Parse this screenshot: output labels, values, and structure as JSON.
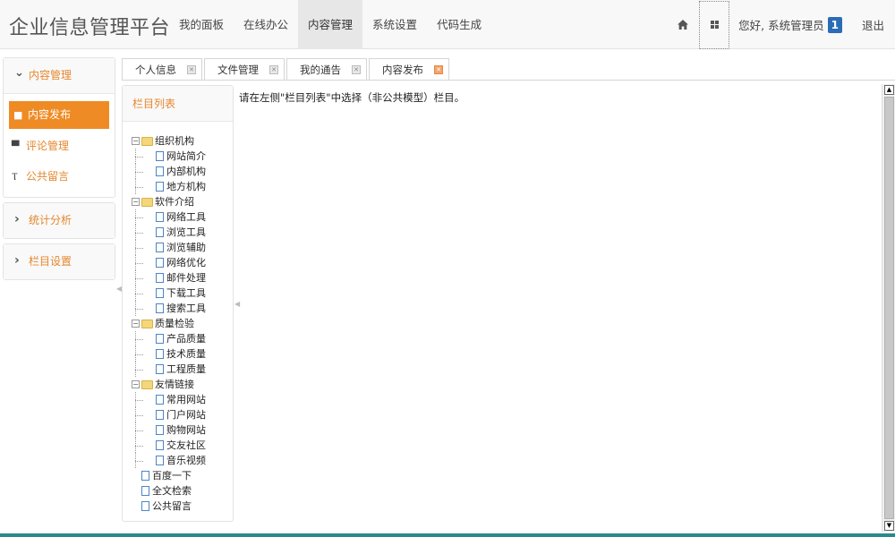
{
  "brand": "企业信息管理平台",
  "nav": {
    "items": [
      "我的面板",
      "在线办公",
      "内容管理",
      "系统设置",
      "代码生成"
    ],
    "active": 2,
    "user_greeting": "您好, 系统管理员",
    "badge": "1",
    "logout": "退出"
  },
  "sidebar": {
    "sections": [
      {
        "label": "内容管理",
        "expanded": true,
        "items": [
          {
            "label": "内容发布",
            "icon": "briefcase-icon",
            "active": true
          },
          {
            "label": "评论管理",
            "icon": "comment-icon",
            "active": false
          },
          {
            "label": "公共留言",
            "icon": "filter-icon",
            "active": false
          }
        ]
      },
      {
        "label": "统计分析",
        "expanded": false,
        "items": []
      },
      {
        "label": "栏目设置",
        "expanded": false,
        "items": []
      }
    ]
  },
  "tabs": [
    {
      "label": "个人信息",
      "active": false
    },
    {
      "label": "文件管理",
      "active": false
    },
    {
      "label": "我的通告",
      "active": false
    },
    {
      "label": "内容发布",
      "active": true
    }
  ],
  "tree": {
    "title": "栏目列表",
    "nodes": [
      {
        "label": "组织机构",
        "children": [
          "网站简介",
          "内部机构",
          "地方机构"
        ]
      },
      {
        "label": "软件介绍",
        "children": [
          "网络工具",
          "浏览工具",
          "浏览辅助",
          "网络优化",
          "邮件处理",
          "下载工具",
          "搜索工具"
        ]
      },
      {
        "label": "质量检验",
        "children": [
          "产品质量",
          "技术质量",
          "工程质量"
        ]
      },
      {
        "label": "友情链接",
        "children": [
          "常用网站",
          "门户网站",
          "购物网站",
          "交友社区",
          "音乐视频"
        ]
      },
      {
        "label": "百度一下",
        "children": null
      },
      {
        "label": "全文检索",
        "children": null
      },
      {
        "label": "公共留言",
        "children": null
      }
    ]
  },
  "content": {
    "hint": "请在左侧\"栏目列表\"中选择（非公共模型）栏目。"
  },
  "colors": {
    "accent": "#ef8b24",
    "accent_text": "#e5872e",
    "badge": "#2b6cb5"
  }
}
